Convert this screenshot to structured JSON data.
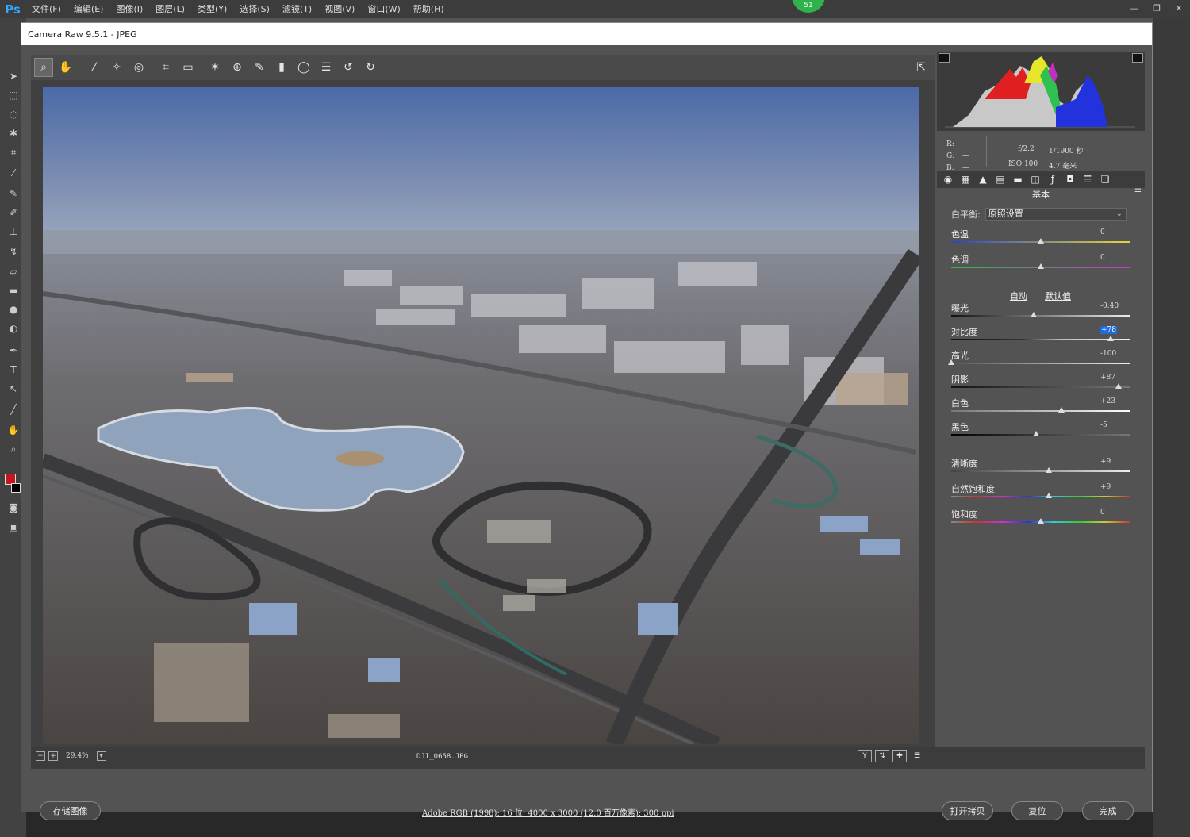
{
  "ps": {
    "logo": "Ps",
    "menu": [
      "文件(F)",
      "编辑(E)",
      "图像(I)",
      "图层(L)",
      "类型(Y)",
      "选择(S)",
      "滤镜(T)",
      "视图(V)",
      "窗口(W)",
      "帮助(H)"
    ],
    "badge": "51"
  },
  "camera_raw": {
    "title": "Camera Raw 9.5.1 -  JPEG",
    "zoom": "29.4%",
    "filename": "DJI_0658.JPG",
    "workflow": "Adobe RGB (1998); 16 位; 4000 x 3000 (12.0 百万像素); 300 ppi",
    "buttons": {
      "save": "存储图像",
      "open_copy": "打开拷贝",
      "reset": "复位",
      "done": "完成"
    }
  },
  "info": {
    "r": "R:",
    "g": "G:",
    "b": "B:",
    "dash": "—",
    "aperture": "f/2.2",
    "shutter": "1/1900 秒",
    "iso": "ISO 100",
    "focal": "4.7 毫米"
  },
  "basic_panel": {
    "title": "基本",
    "white_balance_label": "白平衡:",
    "white_balance_value": "原照设置",
    "auto": "自动",
    "default": "默认值",
    "controls": [
      {
        "label": "色温",
        "value": "0",
        "pos": 0.5
      },
      {
        "label": "色调",
        "value": "0",
        "pos": 0.5
      },
      {
        "label": "曝光",
        "value": "-0.40",
        "pos": 0.46
      },
      {
        "label": "对比度",
        "value": "+78",
        "pos": 0.89
      },
      {
        "label": "高光",
        "value": "-100",
        "pos": 0.0
      },
      {
        "label": "阴影",
        "value": "+87",
        "pos": 0.935
      },
      {
        "label": "白色",
        "value": "+23",
        "pos": 0.615
      },
      {
        "label": "黑色",
        "value": "-5",
        "pos": 0.475
      },
      {
        "label": "清晰度",
        "value": "+9",
        "pos": 0.545
      },
      {
        "label": "自然饱和度",
        "value": "+9",
        "pos": 0.545
      },
      {
        "label": "饱和度",
        "value": "0",
        "pos": 0.5
      }
    ]
  },
  "colors": {
    "accent": "#1f6bd9",
    "ps_blue": "#31a8ff",
    "fg_color": "#c4161c"
  }
}
